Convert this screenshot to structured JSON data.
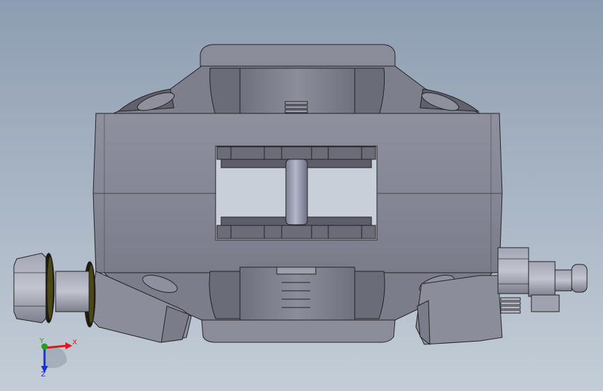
{
  "viewport": {
    "background_top": "#8d9db1",
    "background_bottom": "#c4cdd7",
    "model": "brake-caliper-assembly",
    "view": "front"
  },
  "colors": {
    "body_light": "#8f919f",
    "body_mid": "#777987",
    "body_dark": "#5e606c",
    "pad_color": "#666672",
    "pin_color": "#8d90a6",
    "seal_color": "#1c1a12",
    "seal_ring": "#4a4614",
    "axis_x": "#e01616",
    "axis_y": "#1fa21f",
    "axis_z": "#1a2fd1"
  },
  "triad": {
    "x_label": "X",
    "y_label": "Y",
    "z_label": "Z"
  }
}
